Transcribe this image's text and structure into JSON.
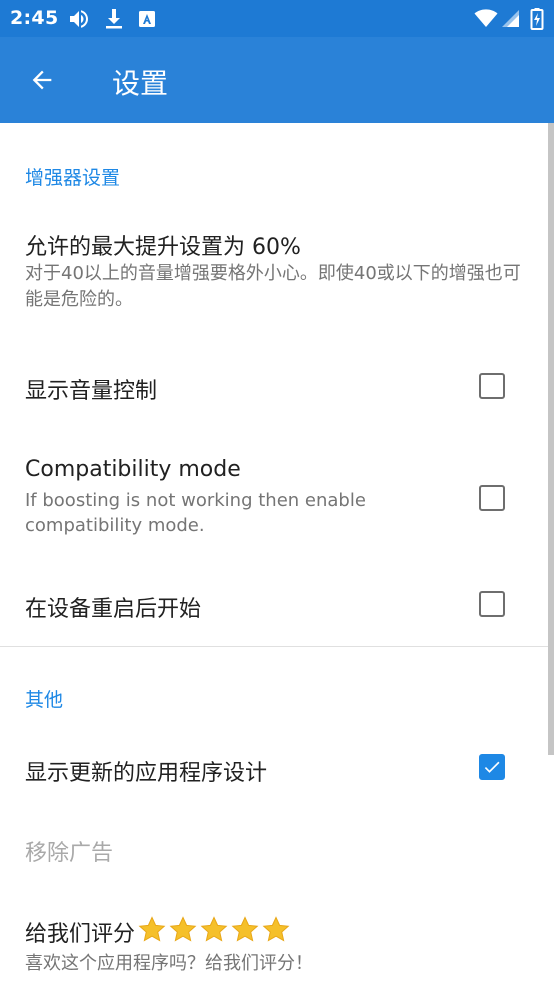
{
  "status_bar": {
    "time": "2:45"
  },
  "app_bar": {
    "title": "设置"
  },
  "sections": {
    "enhancer": {
      "header": "增强器设置"
    },
    "other": {
      "header": "其他"
    }
  },
  "prefs": {
    "max_boost": {
      "title": "允许的最大提升设置为 60%",
      "summary": "对于40以上的音量增强要格外小心。即使40或以下的增强也可能是危险的。"
    },
    "show_volume_control": {
      "title": "显示音量控制",
      "checked": false
    },
    "compatibility_mode": {
      "title": "Compatibility mode",
      "summary": "If boosting is not working then enable compatibility mode.",
      "checked": false
    },
    "start_on_boot": {
      "title": "在设备重启后开始",
      "checked": false
    },
    "new_design": {
      "title": "显示更新的应用程序设计",
      "checked": true
    },
    "remove_ads": {
      "title": "移除广告",
      "enabled": false
    },
    "rate_us": {
      "title": "给我们评分",
      "summary": "喜欢这个应用程序吗？给我们评分！",
      "star_count": 5
    }
  },
  "colors": {
    "status_bar": "#1e7ad4",
    "app_bar": "#2a82d8",
    "accent": "#1e88e5",
    "star": "#f5c02a"
  }
}
